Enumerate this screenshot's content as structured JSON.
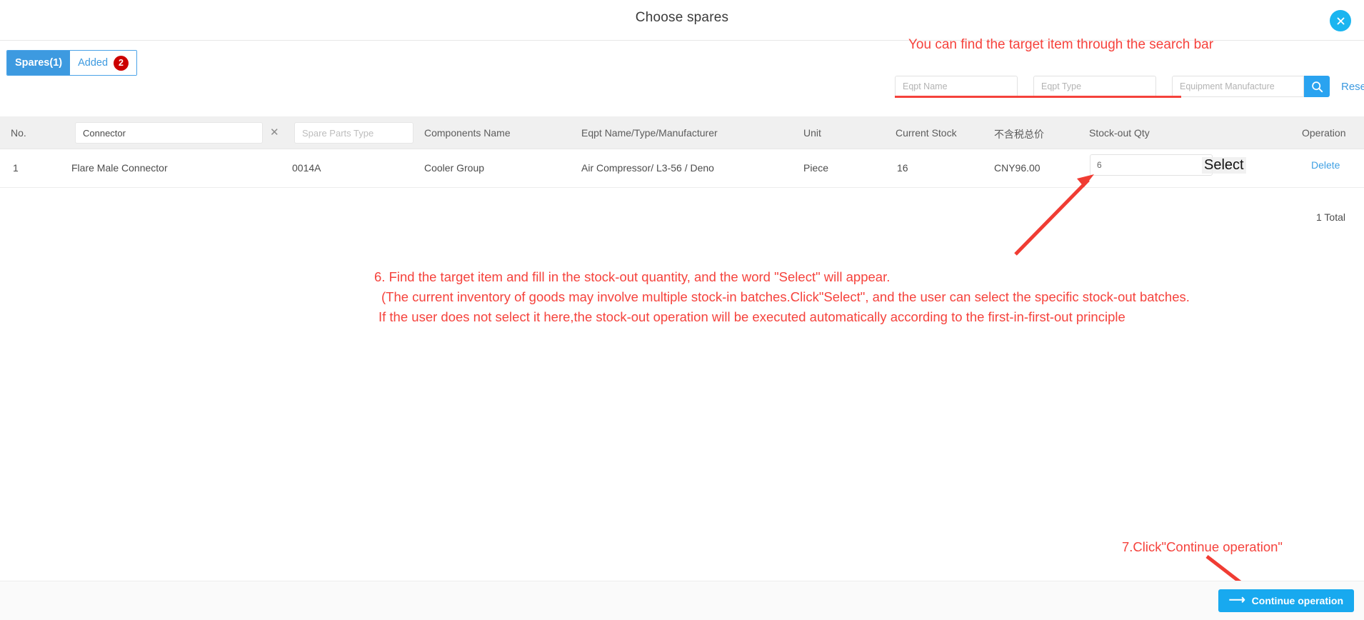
{
  "dialog": {
    "title": "Choose spares",
    "close_icon": "close-circle-icon"
  },
  "tabs": [
    {
      "label": "Spares(1)",
      "active": true,
      "badge": ""
    },
    {
      "label": "Added",
      "active": false,
      "badge": "2"
    }
  ],
  "search": {
    "note": "You can find the target item through the search bar",
    "eqpt_name_placeholder": "Eqpt Name",
    "eqpt_name_value": "",
    "eqpt_type_placeholder": "Eqpt Type",
    "eqpt_type_value": "",
    "manufacture_placeholder": "Equipment Manufacture",
    "manufacture_value": "",
    "search_icon": "magnifier-icon",
    "reset_label": "Reset",
    "reset_icon": "refresh-icon"
  },
  "table": {
    "columns": [
      "No.",
      "",
      "",
      "Components Name",
      "Eqpt Name/Type/Manufacturer",
      "Unit",
      "Current Stock",
      "不含税总价",
      "Stock-out Qty",
      "Operation"
    ],
    "filters": {
      "spare_name_value": "Connector",
      "spare_name_clear_icon": "clear-x-icon",
      "spare_type_placeholder": "Spare Parts Type",
      "spare_type_value": ""
    },
    "rows": [
      {
        "no": "1",
        "spare_name": "Flare Male Connector",
        "spare_code": "0014A",
        "components_name": "Cooler Group",
        "eqpt_info": "Air Compressor/ L3-56 / Deno",
        "unit": "Piece",
        "current_stock": "16",
        "price": "CNY96.00",
        "stock_out_qty": "6",
        "select_label": "Select",
        "operation_label": "Delete"
      }
    ],
    "total_text": "1 Total"
  },
  "annotations": {
    "step6_line1": "6. Find the target item and fill in the stock-out quantity, and the word \"Select\" will appear.",
    "step6_line2": "(The current inventory of goods may involve multiple stock-in batches.Click\"Select\", and the user can select the specific stock-out batches.",
    "step6_line3": "If the user does not select it here,the stock-out operation will be executed automatically according to the first-in-first-out principle",
    "step7": "7.Click\"Continue operation\""
  },
  "footer": {
    "continue_label": "Continue operation",
    "continue_icon": "arrow-right-icon"
  },
  "colors": {
    "accent_blue": "#2aa3f0",
    "tab_blue": "#3d9ae0",
    "annotation_red": "#f5423c",
    "badge_red": "#cc0000"
  }
}
